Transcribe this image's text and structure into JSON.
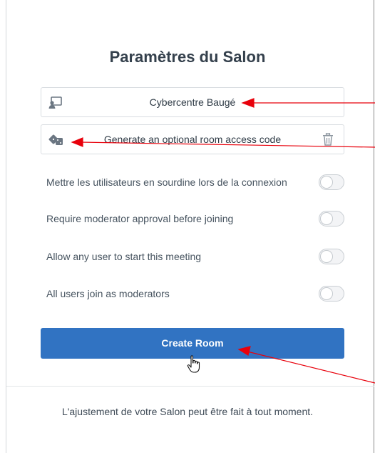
{
  "header": {
    "title": "Paramètres du Salon"
  },
  "fields": {
    "room_name": {
      "value": "Cybercentre Baugé",
      "icon": "user-room-icon"
    },
    "access_code": {
      "placeholder": "Generate an optional room access code",
      "icon": "dice-icon",
      "delete_icon": "trash-icon"
    }
  },
  "toggles": [
    {
      "label": "Mettre les utilisateurs en sourdine lors de la connexion",
      "checked": false
    },
    {
      "label": "Require moderator approval before joining",
      "checked": false
    },
    {
      "label": "Allow any user to start this meeting",
      "checked": false
    },
    {
      "label": "All users join as moderators",
      "checked": false
    }
  ],
  "actions": {
    "create_label": "Create Room"
  },
  "footer": {
    "text": "L'ajustement de votre Salon peut être fait à tout moment."
  },
  "colors": {
    "primary": "#3173c2",
    "annotation": "#e8000b"
  }
}
